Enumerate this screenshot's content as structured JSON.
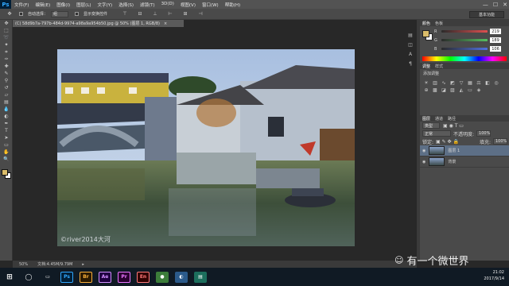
{
  "app": {
    "logo": "Ps"
  },
  "menu": [
    "文件(F)",
    "编辑(E)",
    "图像(I)",
    "图层(L)",
    "文字(Y)",
    "选择(S)",
    "滤镜(T)",
    "3D(D)",
    "视图(V)",
    "窗口(W)",
    "帮助(H)"
  ],
  "window_controls": [
    "—",
    "☐",
    "✕"
  ],
  "options_bar": {
    "auto_select_label": "自动选择：",
    "auto_select_value": "组",
    "show_transform_label": "显示变换控件"
  },
  "workspace": "基本功能",
  "document": {
    "tab_title": "(C) 58d9b7a-797b-484d-9974-a98a9a954b50.jpg @ 50% (图层 1, RGB/8)",
    "close": "×",
    "photo_caption": "©river2014大河"
  },
  "status": {
    "zoom": "50%",
    "doc_size": "文档:4.45M/9.79M"
  },
  "tools": [
    "move-icon",
    "marquee-icon",
    "lasso-icon",
    "magic-wand-icon",
    "crop-icon",
    "eyedropper-icon",
    "healing-icon",
    "brush-icon",
    "stamp-icon",
    "history-brush-icon",
    "eraser-icon",
    "gradient-icon",
    "blur-icon",
    "dodge-icon",
    "pen-icon",
    "text-icon",
    "path-select-icon",
    "rectangle-icon",
    "hand-icon",
    "zoom-icon"
  ],
  "color_panel": {
    "tabs": [
      "颜色",
      "色板"
    ],
    "rows": [
      {
        "label": "R",
        "value": "219",
        "track": "linear-gradient(90deg,#2a2a2a,#e05050)"
      },
      {
        "label": "G",
        "value": "189",
        "track": "linear-gradient(90deg,#2a2a2a,#55c060)"
      },
      {
        "label": "B",
        "value": "106",
        "track": "linear-gradient(90deg,#2a2a2a,#5070e0)"
      }
    ],
    "foreground": "#dbbd6a",
    "background": "#ffffff"
  },
  "adjustments_panel": {
    "tabs": [
      "调整",
      "样式"
    ],
    "title": "添加调整"
  },
  "layers_panel": {
    "tabs": [
      "图层",
      "通道",
      "路径"
    ],
    "kind": "类型",
    "blend_mode": "正常",
    "opacity_label": "不透明度:",
    "opacity_value": "100%",
    "lock_label": "锁定:",
    "fill_label": "填充:",
    "fill_value": "100%",
    "layers": [
      {
        "name": "图层 1",
        "selected": true
      },
      {
        "name": "背景",
        "selected": false
      }
    ]
  },
  "taskbar": {
    "apps": [
      {
        "name": "Ps",
        "color": "#31a8ff",
        "bg": "#001e36"
      },
      {
        "name": "Br",
        "color": "#fbb03b",
        "bg": "#2b1a00"
      },
      {
        "name": "Ae",
        "color": "#d291ff",
        "bg": "#1f0040"
      },
      {
        "name": "Pr",
        "color": "#ea77ff",
        "bg": "#2a0030"
      },
      {
        "name": "En",
        "color": "#ff7a7a",
        "bg": "#300000"
      }
    ],
    "time": "21:02",
    "date": "2017/9/14"
  },
  "watermark": "有一个微世界"
}
